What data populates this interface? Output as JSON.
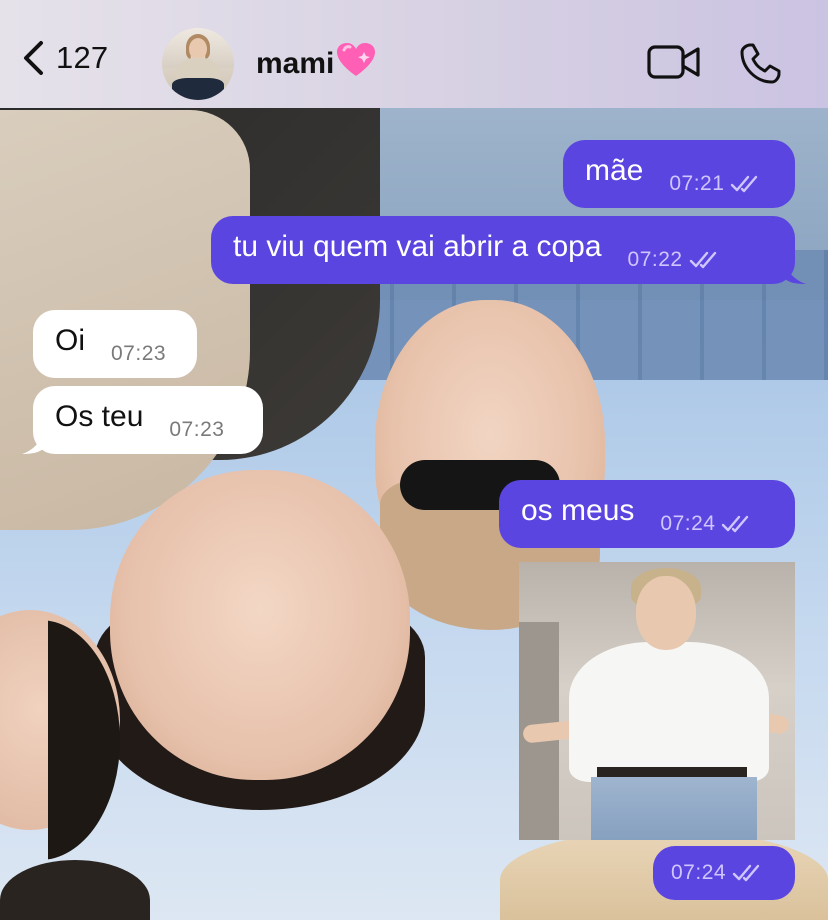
{
  "header": {
    "back_count": "127",
    "contact_name": "mami",
    "contact_emoji": "💗"
  },
  "messages": [
    {
      "text": "mãe",
      "time": "07:21",
      "direction": "outgoing",
      "status": "read"
    },
    {
      "text": "tu viu quem vai abrir a copa",
      "time": "07:22",
      "direction": "outgoing",
      "status": "read"
    },
    {
      "text": "Oi",
      "time": "07:23",
      "direction": "incoming"
    },
    {
      "text": "Os teu",
      "time": "07:23",
      "direction": "incoming"
    },
    {
      "text": "os meus",
      "time": "07:24",
      "direction": "outgoing",
      "status": "read"
    },
    {
      "type": "image",
      "time": "07:24",
      "direction": "outgoing",
      "status": "read"
    }
  ],
  "colors": {
    "outgoing_bubble": "#5b45e0",
    "incoming_bubble": "#ffffff",
    "header_background": "#d7d1e3",
    "heart": "#ff5fb4"
  },
  "icons": {
    "back": "chevron-left-icon",
    "video": "video-camera-icon",
    "phone": "phone-icon",
    "read_status": "double-check-icon"
  }
}
